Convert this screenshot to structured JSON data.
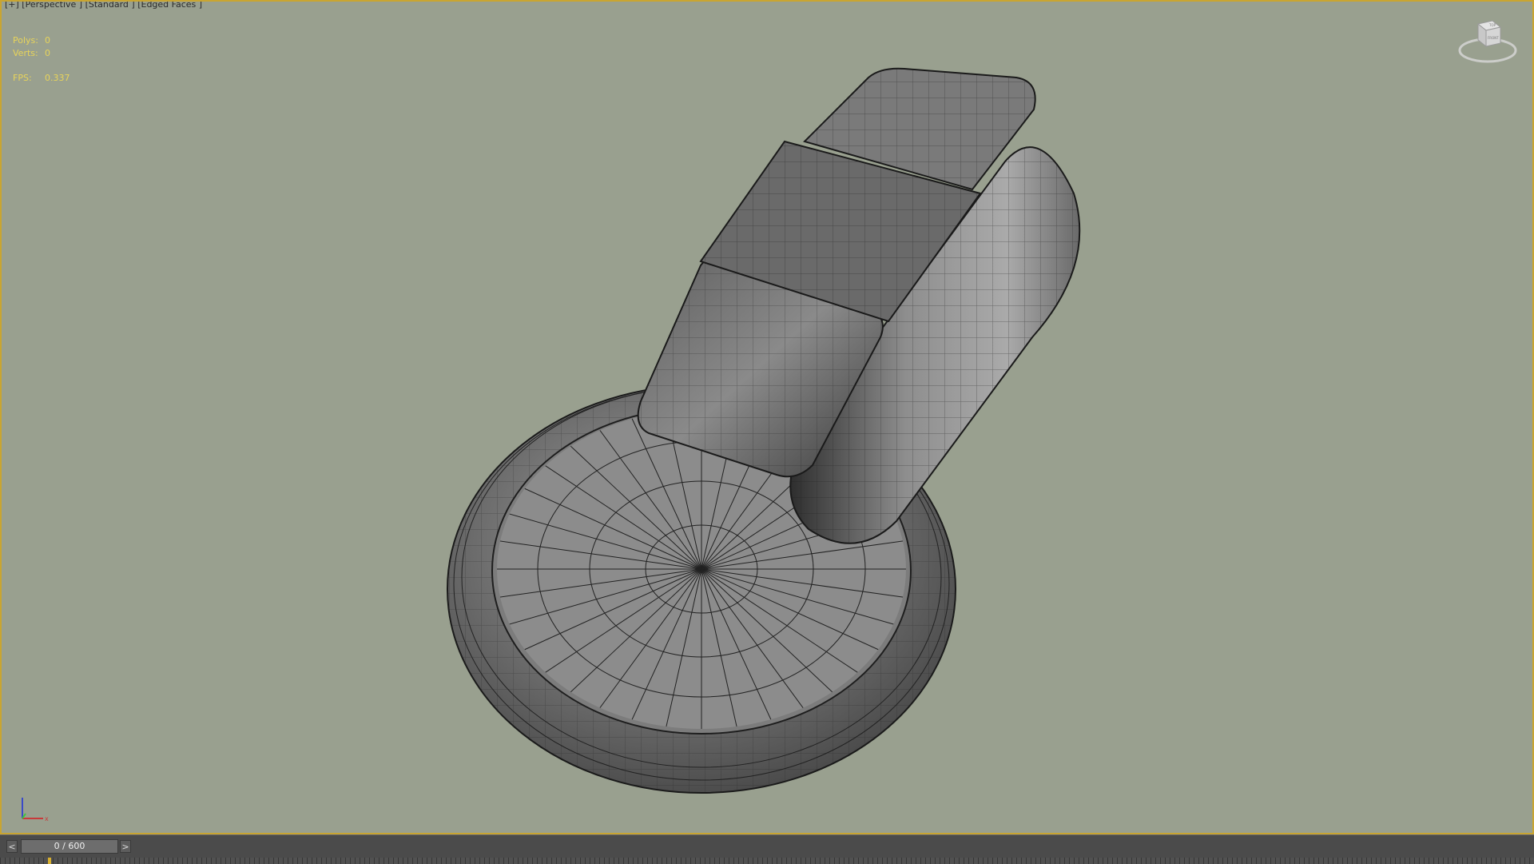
{
  "viewport": {
    "label": "[+] [Perspective ] [Standard ] [Edged Faces ]",
    "stats": [
      {
        "label": "Polys:",
        "value": "0"
      },
      {
        "label": "Verts:",
        "value": "0"
      },
      {
        "label": "FPS:",
        "value": "0.337"
      }
    ],
    "viewcube": {
      "top_label": "TOP",
      "front_label": "FRONT"
    },
    "axis": {
      "x_label": "x"
    }
  },
  "timeline": {
    "prev_label": "<",
    "next_label": ">",
    "frame_display": "0 / 600"
  },
  "colors": {
    "viewport_bg": "#99a08f",
    "active_border": "#c9a531",
    "stats_text": "#e8d45a",
    "timeline_bg": "#4b4b4b"
  }
}
